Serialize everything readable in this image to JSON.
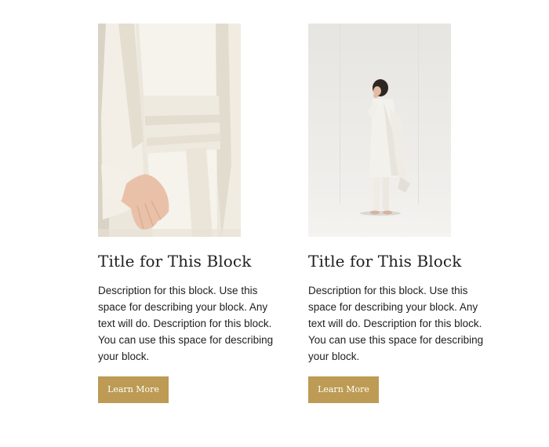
{
  "cards": [
    {
      "title": "Title for This Block",
      "description": "Description for this block. Use this space for describing your block. Any text will do. Description for this block. You can use this space for describing your block.",
      "button_label": "Learn More"
    },
    {
      "title": "Title for This Block",
      "description": "Description for this block. Use this space for describing your block. Any text will do. Description for this block. You can use this space for describing your block.",
      "button_label": "Learn More"
    }
  ],
  "colors": {
    "accent": "#bd9b54",
    "text": "#1e1e1e",
    "background": "#ffffff"
  }
}
